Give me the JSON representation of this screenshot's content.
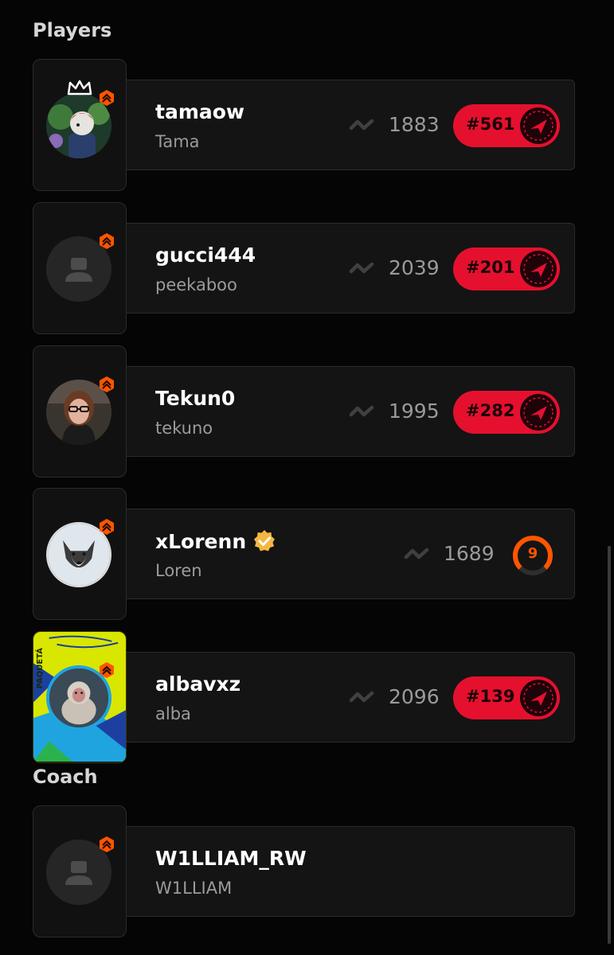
{
  "sections": {
    "players_title": "Players",
    "coach_title": "Coach"
  },
  "players": [
    {
      "nickname": "tamaow",
      "name": "Tama",
      "elo": "1883",
      "rank": "#561"
    },
    {
      "nickname": "gucci444",
      "name": "peekaboo",
      "elo": "2039",
      "rank": "#201"
    },
    {
      "nickname": "Tekun0",
      "name": "tekuno",
      "elo": "1995",
      "rank": "#282"
    },
    {
      "nickname": "xLorenn",
      "name": "Loren",
      "elo": "1689",
      "level": "9"
    },
    {
      "nickname": "albavxz",
      "name": "alba",
      "elo": "2096",
      "rank": "#139",
      "frame_text": "PAQUETÁ"
    }
  ],
  "coach": {
    "nickname": "W1LLIAM_RW",
    "name": "W1LLIAM"
  },
  "colors": {
    "background": "#050505",
    "card": "#141414",
    "rank_red": "#e5102e",
    "accent_orange": "#ff5500",
    "verified_gold": "#f4b840"
  },
  "icons": [
    "crown-icon",
    "level-badge-icon",
    "elo-icon",
    "challenger-rank-icon",
    "verified-icon",
    "default-avatar-icon",
    "skill-level-ring"
  ]
}
